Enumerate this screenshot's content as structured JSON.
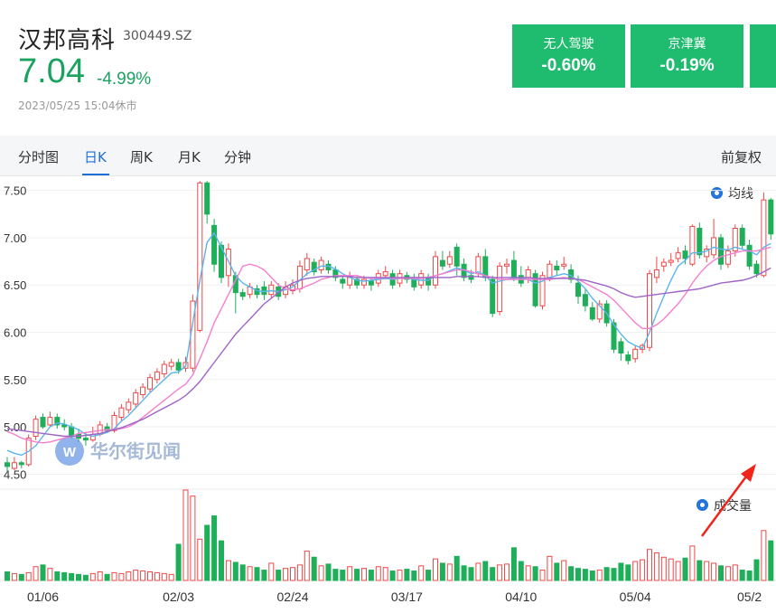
{
  "stock": {
    "name": "汉邦高科",
    "code": "300449.SZ",
    "price": "7.04",
    "change_pct": "-4.99%",
    "timestamp": "2023/05/25 15:04休市"
  },
  "sectors": [
    {
      "name": "无人驾驶",
      "change": "-0.60%"
    },
    {
      "name": "京津冀",
      "change": "-0.19%"
    }
  ],
  "tabs": [
    "分时图",
    "日K",
    "周K",
    "月K",
    "分钟"
  ],
  "active_tab": "日K",
  "adjust_label": "前复权",
  "legend": {
    "ma": "均线",
    "volume": "成交量"
  },
  "watermark": "华尔街见闻",
  "colors": {
    "up": "#f04848",
    "down": "#1fae5a",
    "ma5": "#5bb5ea",
    "ma10": "#f47fd0",
    "ma20": "#9f64c8",
    "accent": "#1e6fd9"
  },
  "chart_data": {
    "type": "candlestick",
    "yticks": [
      "7.50",
      "7.00",
      "6.50",
      "6.00",
      "5.50",
      "5.00",
      "4.50"
    ],
    "ylim": [
      4.35,
      7.65
    ],
    "xticks": [
      "01/06",
      "02/03",
      "02/24",
      "03/17",
      "04/10",
      "05/04",
      "05/2"
    ],
    "xtick_index": [
      5,
      24,
      40,
      56,
      72,
      88,
      104
    ],
    "ohlc": [
      [
        4.62,
        4.58,
        4.68,
        4.52
      ],
      [
        4.56,
        4.62,
        4.68,
        4.54
      ],
      [
        4.62,
        4.6,
        4.64,
        4.56
      ],
      [
        4.6,
        4.88,
        4.92,
        4.58
      ],
      [
        4.9,
        5.08,
        5.12,
        4.86
      ],
      [
        5.1,
        5.0,
        5.14,
        4.98
      ],
      [
        5.02,
        5.1,
        5.16,
        5.0
      ],
      [
        5.1,
        5.02,
        5.14,
        4.98
      ],
      [
        5.02,
        5.0,
        5.08,
        4.96
      ],
      [
        5.0,
        4.9,
        5.04,
        4.88
      ],
      [
        4.92,
        4.88,
        4.98,
        4.84
      ],
      [
        4.88,
        4.86,
        4.94,
        4.8
      ],
      [
        4.86,
        4.92,
        5.0,
        4.84
      ],
      [
        4.92,
        5.02,
        5.06,
        4.9
      ],
      [
        5.0,
        4.96,
        5.04,
        4.94
      ],
      [
        4.96,
        5.12,
        5.16,
        4.94
      ],
      [
        5.1,
        5.2,
        5.24,
        5.06
      ],
      [
        5.18,
        5.26,
        5.3,
        5.14
      ],
      [
        5.24,
        5.36,
        5.4,
        5.2
      ],
      [
        5.34,
        5.42,
        5.46,
        5.3
      ],
      [
        5.4,
        5.52,
        5.56,
        5.36
      ],
      [
        5.5,
        5.58,
        5.62,
        5.46
      ],
      [
        5.56,
        5.66,
        5.7,
        5.52
      ],
      [
        5.64,
        5.68,
        5.72,
        5.6
      ],
      [
        5.68,
        5.6,
        5.72,
        5.56
      ],
      [
        5.62,
        5.68,
        5.74,
        5.58
      ],
      [
        5.62,
        6.33,
        6.4,
        5.58
      ],
      [
        6.02,
        7.58,
        7.6,
        6.0
      ],
      [
        7.58,
        7.25,
        7.6,
        7.15
      ],
      [
        7.13,
        6.72,
        7.2,
        6.64
      ],
      [
        6.92,
        6.58,
        6.96,
        6.52
      ],
      [
        6.6,
        6.88,
        6.94,
        6.48
      ],
      [
        6.6,
        6.42,
        6.64,
        6.2
      ],
      [
        6.42,
        6.38,
        6.46,
        6.34
      ],
      [
        6.4,
        6.48,
        6.52,
        6.36
      ],
      [
        6.46,
        6.4,
        6.5,
        6.36
      ],
      [
        6.48,
        6.4,
        6.54,
        6.34
      ],
      [
        6.4,
        6.5,
        6.54,
        6.36
      ],
      [
        6.48,
        6.38,
        6.52,
        6.34
      ],
      [
        6.4,
        6.48,
        6.54,
        6.36
      ],
      [
        6.44,
        6.5,
        6.56,
        6.4
      ],
      [
        6.46,
        6.7,
        6.76,
        6.42
      ],
      [
        6.66,
        6.78,
        6.84,
        6.6
      ],
      [
        6.74,
        6.64,
        6.78,
        6.6
      ],
      [
        6.66,
        6.76,
        6.8,
        6.62
      ],
      [
        6.72,
        6.66,
        6.76,
        6.62
      ],
      [
        6.66,
        6.58,
        6.7,
        6.54
      ],
      [
        6.56,
        6.52,
        6.6,
        6.46
      ],
      [
        6.5,
        6.58,
        6.64,
        6.46
      ],
      [
        6.56,
        6.5,
        6.6,
        6.46
      ],
      [
        6.5,
        6.56,
        6.6,
        6.46
      ],
      [
        6.54,
        6.5,
        6.58,
        6.44
      ],
      [
        6.52,
        6.62,
        6.66,
        6.48
      ],
      [
        6.6,
        6.64,
        6.7,
        6.56
      ],
      [
        6.62,
        6.5,
        6.66,
        6.46
      ],
      [
        6.52,
        6.62,
        6.66,
        6.48
      ],
      [
        6.6,
        6.56,
        6.64,
        6.52
      ],
      [
        6.58,
        6.48,
        6.62,
        6.44
      ],
      [
        6.5,
        6.62,
        6.66,
        6.46
      ],
      [
        6.58,
        6.5,
        6.62,
        6.44
      ],
      [
        6.5,
        6.8,
        6.86,
        6.46
      ],
      [
        6.76,
        6.7,
        6.86,
        6.66
      ],
      [
        6.72,
        6.8,
        6.86,
        6.68
      ],
      [
        6.9,
        6.7,
        6.94,
        6.6
      ],
      [
        6.72,
        6.58,
        6.78,
        6.54
      ],
      [
        6.6,
        6.56,
        6.66,
        6.52
      ],
      [
        6.62,
        6.8,
        6.84,
        6.58
      ],
      [
        6.8,
        6.58,
        6.88,
        6.54
      ],
      [
        6.56,
        6.2,
        6.6,
        6.16
      ],
      [
        6.22,
        6.7,
        6.74,
        6.18
      ],
      [
        6.7,
        6.72,
        6.78,
        6.62
      ],
      [
        6.76,
        6.58,
        6.86,
        6.54
      ],
      [
        6.6,
        6.52,
        6.7,
        6.48
      ],
      [
        6.58,
        6.66,
        6.7,
        6.52
      ],
      [
        6.62,
        6.28,
        6.66,
        6.26
      ],
      [
        6.28,
        6.6,
        6.64,
        6.24
      ],
      [
        6.58,
        6.72,
        6.76,
        6.54
      ],
      [
        6.7,
        6.66,
        6.76,
        6.6
      ],
      [
        6.7,
        6.72,
        6.8,
        6.66
      ],
      [
        6.66,
        6.56,
        6.72,
        6.52
      ],
      [
        6.52,
        6.38,
        6.6,
        6.3
      ],
      [
        6.4,
        6.28,
        6.46,
        6.22
      ],
      [
        6.26,
        6.14,
        6.32,
        6.12
      ],
      [
        6.14,
        6.3,
        6.34,
        6.1
      ],
      [
        6.3,
        6.1,
        6.34,
        6.06
      ],
      [
        6.1,
        5.82,
        6.14,
        5.78
      ],
      [
        5.9,
        5.78,
        5.94,
        5.7
      ],
      [
        5.76,
        5.7,
        5.8,
        5.66
      ],
      [
        5.72,
        5.82,
        5.86,
        5.68
      ],
      [
        5.82,
        5.86,
        5.88,
        5.78
      ],
      [
        5.84,
        6.62,
        6.66,
        5.8
      ],
      [
        6.58,
        6.66,
        6.8,
        6.52
      ],
      [
        6.7,
        6.74,
        6.78,
        6.64
      ],
      [
        6.74,
        6.76,
        6.84,
        6.7
      ],
      [
        6.78,
        6.84,
        6.9,
        6.74
      ],
      [
        6.86,
        6.78,
        6.92,
        6.72
      ],
      [
        6.72,
        7.12,
        7.14,
        6.7
      ],
      [
        7.1,
        6.82,
        7.16,
        6.78
      ],
      [
        6.8,
        6.88,
        6.92,
        6.74
      ],
      [
        6.82,
        7.0,
        7.2,
        6.78
      ],
      [
        7.0,
        6.72,
        7.04,
        6.66
      ],
      [
        6.72,
        6.86,
        6.92,
        6.68
      ],
      [
        6.86,
        7.1,
        7.14,
        6.8
      ],
      [
        7.1,
        6.92,
        7.14,
        6.88
      ],
      [
        6.92,
        6.7,
        6.98,
        6.66
      ],
      [
        6.72,
        6.62,
        6.76,
        6.58
      ],
      [
        6.6,
        7.4,
        7.48,
        6.58
      ],
      [
        7.4,
        7.04,
        7.42,
        6.98
      ]
    ],
    "volume": [
      10,
      8,
      7,
      9,
      16,
      18,
      14,
      10,
      9,
      8,
      7,
      6,
      8,
      10,
      7,
      9,
      8,
      10,
      12,
      11,
      10,
      9,
      8,
      7,
      42,
      105,
      98,
      48,
      64,
      75,
      46,
      23,
      21,
      18,
      16,
      15,
      12,
      20,
      12,
      14,
      15,
      18,
      34,
      27,
      17,
      19,
      13,
      12,
      16,
      13,
      14,
      12,
      16,
      15,
      11,
      12,
      13,
      11,
      17,
      12,
      25,
      20,
      19,
      28,
      17,
      15,
      20,
      22,
      15,
      18,
      19,
      38,
      22,
      17,
      16,
      12,
      28,
      20,
      23,
      16,
      14,
      13,
      11,
      12,
      15,
      14,
      20,
      18,
      22,
      24,
      36,
      32,
      27,
      25,
      22,
      26,
      40,
      23,
      22,
      20,
      17,
      16,
      18,
      12,
      11,
      24,
      58,
      46
    ],
    "ma5": [
      4.75,
      4.72,
      4.7,
      4.74,
      4.8,
      4.9,
      5.0,
      5.04,
      5.03,
      5.0,
      4.97,
      4.92,
      4.9,
      4.92,
      4.94,
      4.98,
      5.06,
      5.12,
      5.2,
      5.28,
      5.36,
      5.43,
      5.5,
      5.57,
      5.58,
      5.64,
      6.1,
      6.55,
      6.95,
      7.05,
      6.9,
      6.75,
      6.6,
      6.52,
      6.48,
      6.44,
      6.43,
      6.44,
      6.43,
      6.45,
      6.48,
      6.55,
      6.62,
      6.66,
      6.7,
      6.7,
      6.67,
      6.62,
      6.58,
      6.55,
      6.54,
      6.55,
      6.56,
      6.57,
      6.56,
      6.57,
      6.58,
      6.56,
      6.55,
      6.55,
      6.6,
      6.62,
      6.65,
      6.68,
      6.66,
      6.62,
      6.64,
      6.6,
      6.52,
      6.54,
      6.56,
      6.57,
      6.58,
      6.56,
      6.52,
      6.54,
      6.58,
      6.6,
      6.62,
      6.6,
      6.54,
      6.46,
      6.36,
      6.28,
      6.2,
      6.08,
      5.98,
      5.9,
      5.86,
      5.83,
      6.0,
      6.2,
      6.38,
      6.55,
      6.7,
      6.76,
      6.84,
      6.84,
      6.86,
      6.9,
      6.88,
      6.87,
      6.9,
      6.88,
      6.86,
      6.82,
      6.9,
      6.94
    ],
    "ma10": [
      4.95,
      4.92,
      4.88,
      4.86,
      4.84,
      4.83,
      4.84,
      4.86,
      4.88,
      4.9,
      4.93,
      4.94,
      4.95,
      4.96,
      4.97,
      4.97,
      4.98,
      5.0,
      5.04,
      5.1,
      5.16,
      5.22,
      5.28,
      5.34,
      5.4,
      5.45,
      5.55,
      5.72,
      5.9,
      6.1,
      6.25,
      6.4,
      6.55,
      6.7,
      6.72,
      6.7,
      6.66,
      6.58,
      6.5,
      6.46,
      6.45,
      6.46,
      6.49,
      6.52,
      6.56,
      6.58,
      6.6,
      6.6,
      6.6,
      6.6,
      6.58,
      6.57,
      6.57,
      6.58,
      6.57,
      6.57,
      6.57,
      6.57,
      6.57,
      6.58,
      6.6,
      6.62,
      6.64,
      6.66,
      6.66,
      6.64,
      6.62,
      6.6,
      6.58,
      6.56,
      6.56,
      6.56,
      6.56,
      6.56,
      6.56,
      6.56,
      6.56,
      6.57,
      6.58,
      6.57,
      6.56,
      6.52,
      6.48,
      6.44,
      6.4,
      6.34,
      6.26,
      6.18,
      6.1,
      6.04,
      6.04,
      6.08,
      6.14,
      6.22,
      6.3,
      6.4,
      6.52,
      6.62,
      6.7,
      6.76,
      6.8,
      6.82,
      6.84,
      6.86,
      6.86,
      6.86,
      6.88,
      6.9
    ],
    "ma20": [
      4.98,
      4.97,
      4.96,
      4.95,
      4.94,
      4.93,
      4.92,
      4.91,
      4.9,
      4.9,
      4.9,
      4.91,
      4.92,
      4.93,
      4.95,
      4.97,
      4.99,
      5.02,
      5.05,
      5.08,
      5.12,
      5.16,
      5.2,
      5.24,
      5.28,
      5.33,
      5.4,
      5.48,
      5.58,
      5.68,
      5.78,
      5.88,
      5.98,
      6.06,
      6.14,
      6.22,
      6.3,
      6.36,
      6.42,
      6.48,
      6.52,
      6.55,
      6.57,
      6.58,
      6.59,
      6.59,
      6.59,
      6.59,
      6.59,
      6.58,
      6.58,
      6.58,
      6.58,
      6.58,
      6.58,
      6.58,
      6.58,
      6.58,
      6.58,
      6.58,
      6.58,
      6.58,
      6.58,
      6.59,
      6.59,
      6.59,
      6.59,
      6.58,
      6.58,
      6.58,
      6.58,
      6.58,
      6.58,
      6.58,
      6.57,
      6.57,
      6.57,
      6.57,
      6.57,
      6.57,
      6.56,
      6.55,
      6.53,
      6.51,
      6.49,
      6.46,
      6.42,
      6.39,
      6.37,
      6.38,
      6.39,
      6.4,
      6.41,
      6.42,
      6.43,
      6.44,
      6.45,
      6.46,
      6.48,
      6.5,
      6.52,
      6.53,
      6.54,
      6.55,
      6.57,
      6.6,
      6.64,
      6.68
    ]
  }
}
